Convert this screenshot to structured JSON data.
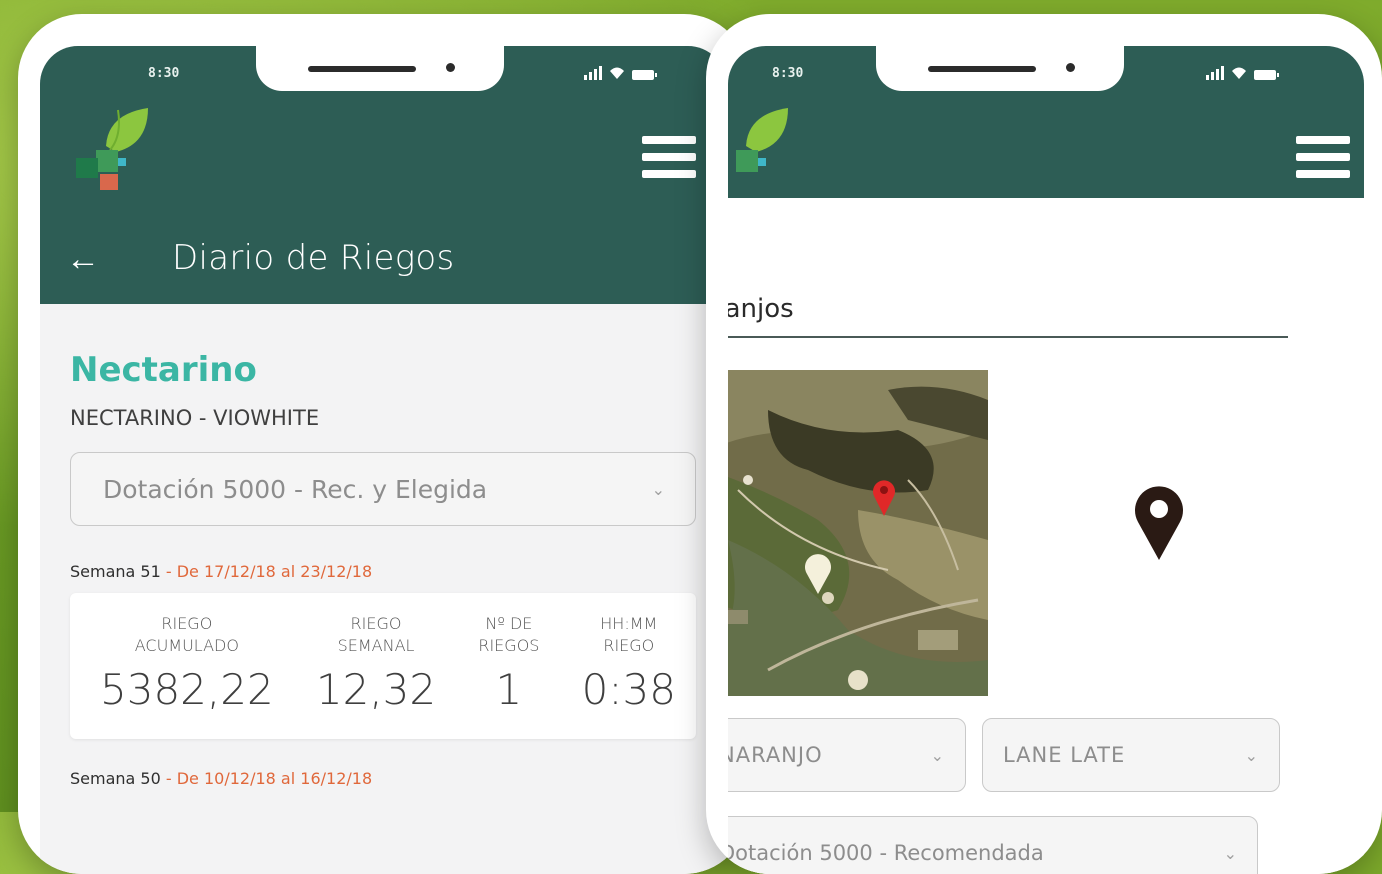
{
  "status_bar": {
    "time": "8:30"
  },
  "left_screen": {
    "header": {
      "title": "Diario de Riegos",
      "back_icon": "arrow-left-icon",
      "menu_icon": "hamburger-menu-icon"
    },
    "crop_title": "Nectarino",
    "variety": "NECTARINO - VIOWHITE",
    "dotacion_select": {
      "value": "Dotación 5000 - Rec. y Elegida"
    },
    "weeks": [
      {
        "label": "Semana 51",
        "range": " - De 17/12/18 al 23/12/18",
        "stats": [
          {
            "label": "RIEGO\nACUMULADO",
            "value": "5382,22"
          },
          {
            "label": "RIEGO\nSEMANAL",
            "value": "12,32"
          },
          {
            "label": "Nº DE\nRIEGOS",
            "value": "1"
          },
          {
            "label": "HH:MM\nRIEGO",
            "value": "0:38"
          }
        ]
      },
      {
        "label": "Semana 50",
        "range": " - De 10/12/18 al 16/12/18"
      }
    ]
  },
  "right_screen": {
    "field_name": "aranjos",
    "crop_select": {
      "value": "NARANJO"
    },
    "variety_select": {
      "value": "LANE LATE"
    },
    "dotacion_select": {
      "value": "Dotación 5000 - Recomendada"
    }
  },
  "colors": {
    "appbar": "#2d5d55",
    "accent_teal": "#3bb6a4",
    "accent_orange": "#e0683b",
    "background_green": "#7fab2c"
  }
}
